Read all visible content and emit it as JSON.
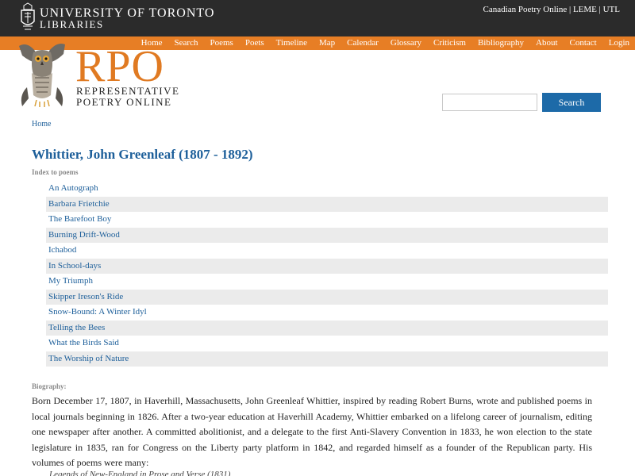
{
  "header": {
    "uoft_line1": "UNIVERSITY OF TORONTO",
    "uoft_line2": "LIBRARIES",
    "top_links": [
      "Canadian Poetry Online",
      "LEME",
      "UTL"
    ],
    "separator": " | "
  },
  "nav": {
    "items": [
      "Home",
      "Search",
      "Poems",
      "Poets",
      "Timeline",
      "Map",
      "Calendar",
      "Glossary",
      "Criticism",
      "Bibliography",
      "About",
      "Contact",
      "Login"
    ]
  },
  "logo": {
    "big": "RPO",
    "sub1": "REPRESENTATIVE",
    "sub2": "POETRY ONLINE"
  },
  "search": {
    "value": "",
    "button_label": "Search"
  },
  "breadcrumb": "Home",
  "title": "Whittier, John Greenleaf (1807 - 1892)",
  "index_label": "Index to poems",
  "poems": [
    "An Autograph",
    "Barbara Frietchie",
    "The Barefoot Boy",
    "Burning Drift-Wood",
    "Ichabod",
    "In School-days",
    "My Triumph",
    "Skipper Ireson's Ride",
    "Snow-Bound: A Winter Idyl",
    "Telling the Bees",
    "What the Birds Said",
    "The Worship of Nature"
  ],
  "bio_label": "Biography:",
  "bio_text": "Born December 17, 1807, in Haverhill, Massachusetts, John Greenleaf Whittier, inspired by reading Robert Burns, wrote and published poems in local journals beginning in 1826. After a two-year education at Haverhill Academy, Whittier embarked on a lifelong career of journalism, editing one newspaper after another. A committed abolitionist, and a delegate to the first Anti-Slavery Convention in 1833, he won election to the state legislature in 1835, ran for Congress on the Liberty party platform in 1842, and regarded himself as a founder of the Republican party. His volumes of poems were many:",
  "bio_cut": "Legends of New-England in Prose and Verse (1831)",
  "colors": {
    "topbar": "#2b2b2b",
    "navbar": "#e77e25",
    "accent": "#1d5f9a",
    "logo_orange": "#e07a22",
    "search_button": "#1d6aa8"
  }
}
